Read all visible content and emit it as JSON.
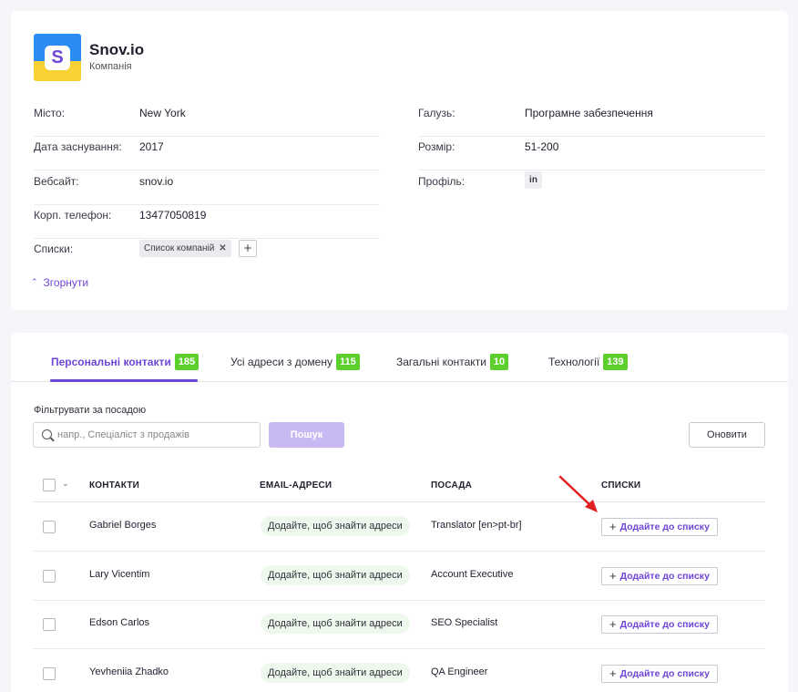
{
  "company": {
    "logo_letter": "S",
    "name": "Snov.io",
    "type": "Компанія",
    "fields_left": [
      {
        "label": "Місто:",
        "value": "New York"
      },
      {
        "label": "Дата заснування:",
        "value": "2017"
      },
      {
        "label": "Вебсайт:",
        "value": "snov.io"
      },
      {
        "label": "Корп. телефон:",
        "value": "13477050819"
      },
      {
        "label": "Списки:",
        "value": ""
      }
    ],
    "fields_right": [
      {
        "label": "Галузь:",
        "value": "Програмне забезпечення"
      },
      {
        "label": "Розмір:",
        "value": "51-200"
      },
      {
        "label": "Профіль:",
        "value": "in"
      }
    ],
    "list_chip": "Список компаній",
    "collapse_label": "Згорнути"
  },
  "tabs": [
    {
      "label": "Персональні контакти",
      "count": "185"
    },
    {
      "label": "Усі адреси з домену",
      "count": "115"
    },
    {
      "label": "Загальні контакти",
      "count": "10"
    },
    {
      "label": "Технології",
      "count": "139"
    }
  ],
  "filter": {
    "label": "Фільтрувати за посадою",
    "placeholder": "напр., Спеціаліст з продажів",
    "search_button": "Пошук",
    "refresh_button": "Оновити"
  },
  "table": {
    "headers": [
      "КОНТАКТИ",
      "EMAIL-АДРЕСИ",
      "ПОСАДА",
      "СПИСКИ"
    ],
    "rows": [
      {
        "name": "Gabriel Borges",
        "email": "Додайте, щоб знайти адреси",
        "position": "Translator [en>pt-br]",
        "list_action": "Додайте до списку"
      },
      {
        "name": "Lary Vicentim",
        "email": "Додайте, щоб знайти адреси",
        "position": "Account Executive",
        "list_action": "Додайте до списку"
      },
      {
        "name": "Edson Carlos",
        "email": "Додайте, щоб знайти адреси",
        "position": "SEO Specialist",
        "list_action": "Додайте до списку"
      },
      {
        "name": "Yevheniia Zhadko",
        "email": "Додайте, щоб знайти адреси",
        "position": "QA Engineer",
        "list_action": "Додайте до списку"
      }
    ]
  },
  "colors": {
    "accent": "#6e46d6",
    "count_badge": "#5ccf2c",
    "annotation_arrow": "#e02020"
  }
}
